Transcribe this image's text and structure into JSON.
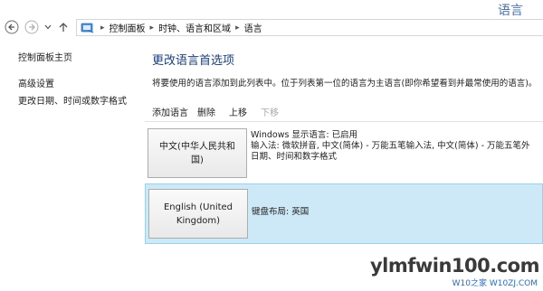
{
  "window": {
    "title": "语言"
  },
  "nav": {
    "breadcrumbs": [
      "控制面板",
      "时钟、语言和区域",
      "语言"
    ],
    "icons": {
      "back": "back-arrow-icon",
      "forward": "forward-arrow-icon",
      "dropdown": "chevron-down-icon",
      "up": "up-arrow-icon",
      "location": "control-panel-icon"
    }
  },
  "sidebar": {
    "items": [
      {
        "label": "控制面板主页"
      },
      {
        "label": "高级设置"
      },
      {
        "label": "更改日期、时间或数字格式"
      }
    ]
  },
  "main": {
    "title": "更改语言首选项",
    "description": "将要使用的语言添加到此列表中。位于列表第一位的语言为主语言(即你希望看到并最常使用的语言)。",
    "toolbar": {
      "add_label": "添加语言",
      "delete_label": "删除",
      "up_label": "上移",
      "down_label": "下移"
    },
    "languages": [
      {
        "name": "中文(中华人民共和国)",
        "info": [
          "Windows 显示语言: 已启用",
          "输入法: 微软拼音, 中文(简体) - 万能五笔输入法, 中文(简体) - 万能五笔外",
          "日期、时间和数字格式"
        ]
      },
      {
        "name": "English (United Kingdom)",
        "info": [
          "键盘布局: 英国"
        ]
      }
    ]
  },
  "watermark": {
    "main": "ylmfwin100.com",
    "sub": "W10之家 W10ZJ.COM"
  },
  "colors": {
    "title": "#1c3f78",
    "selected_row": "#cde8f6",
    "selected_border": "#9fd0ea",
    "disabled": "#a8a8a8"
  }
}
